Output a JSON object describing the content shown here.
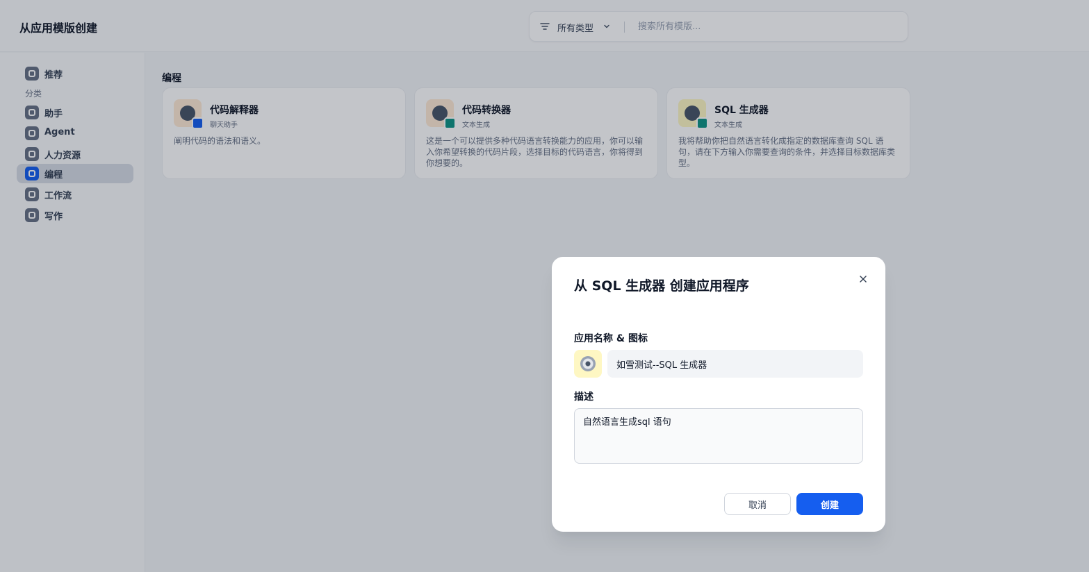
{
  "header": {
    "title": "从应用模版创建",
    "filter_label": "所有类型",
    "search_placeholder": "搜索所有模版..."
  },
  "sidebar": {
    "recommend": "推荐",
    "category_label": "分类",
    "items": [
      {
        "label": "助手"
      },
      {
        "label": "Agent"
      },
      {
        "label": "人力资源"
      },
      {
        "label": "编程",
        "active": true
      },
      {
        "label": "工作流"
      },
      {
        "label": "写作"
      }
    ]
  },
  "main": {
    "section_title": "编程",
    "cards": [
      {
        "name": "代码解释器",
        "type": "聊天助手",
        "description": "阐明代码的语法和语义。"
      },
      {
        "name": "代码转换器",
        "type": "文本生成",
        "description": "这是一个可以提供多种代码语言转换能力的应用，你可以输入你希望转换的代码片段，选择目标的代码语言，你将得到你想要的。"
      },
      {
        "name": "SQL 生成器",
        "type": "文本生成",
        "description": "我将帮助你把自然语言转化成指定的数据库查询 SQL 语句，请在下方输入你需要查询的条件，并选择目标数据库类型。"
      }
    ]
  },
  "modal": {
    "title": "从 SQL 生成器 创建应用程序",
    "name_icon_label": "应用名称 & 图标",
    "app_name": "如雪测试--SQL 生成器",
    "description_label": "描述",
    "description": "自然语言生成sql 语句",
    "cancel_label": "取消",
    "create_label": "创建"
  },
  "colors": {
    "accent": "#155eef",
    "overlay": "rgba(16,24,40,0.25)"
  }
}
